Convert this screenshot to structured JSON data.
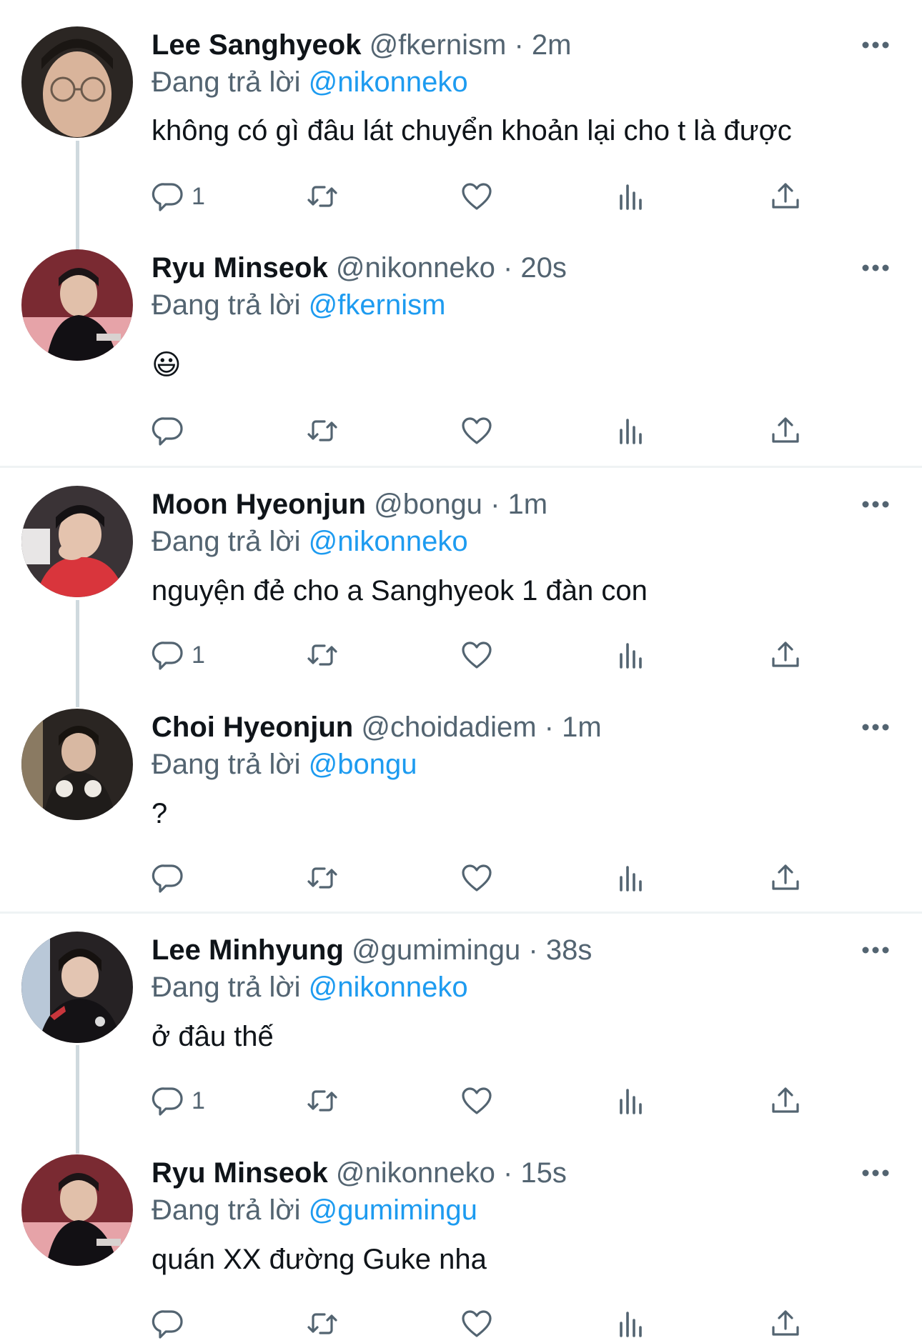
{
  "reply_prefix": "Đang trả lời",
  "threads": [
    {
      "tweets": [
        {
          "name": "Lee Sanghyeok",
          "handle": "@fkernism",
          "time": "2m",
          "replying_to": "@nikonneko",
          "text": "không có gì đâu lát chuyển khoản lại cho t là được",
          "reply_count": "1",
          "avatar": "avatar-photo"
        },
        {
          "name": "Ryu Minseok",
          "handle": "@nikonneko",
          "time": "20s",
          "replying_to": "@fkernism",
          "text": "😃",
          "reply_count": "",
          "avatar": "avatar-photo"
        }
      ]
    },
    {
      "tweets": [
        {
          "name": "Moon Hyeonjun",
          "handle": "@bongu",
          "time": "1m",
          "replying_to": "@nikonneko",
          "text": "nguyện đẻ cho a Sanghyeok 1 đàn con",
          "reply_count": "1",
          "avatar": "avatar-photo"
        },
        {
          "name": "Choi Hyeonjun",
          "handle": "@choidadiem",
          "time": "1m",
          "replying_to": "@bongu",
          "text": "?",
          "reply_count": "",
          "avatar": "avatar-photo"
        }
      ]
    },
    {
      "tweets": [
        {
          "name": "Lee Minhyung",
          "handle": "@gumimingu",
          "time": "38s",
          "replying_to": "@nikonneko",
          "text": "ở đâu thế",
          "reply_count": "1",
          "avatar": "avatar-photo"
        },
        {
          "name": "Ryu Minseok",
          "handle": "@nikonneko",
          "time": "15s",
          "replying_to": "@gumimingu",
          "text": "quán XX đường Guke nha",
          "reply_count": "",
          "avatar": "avatar-photo"
        }
      ]
    }
  ],
  "icons": {
    "reply": "reply-icon",
    "retweet": "retweet-icon",
    "like": "like-icon",
    "views": "views-icon",
    "share": "share-icon",
    "more": "more-icon"
  },
  "colors": {
    "text": "#0f1419",
    "secondary": "#536471",
    "mention": "#1d9bf0",
    "divider": "#eff3f4",
    "thread_line": "#cfd9de"
  }
}
